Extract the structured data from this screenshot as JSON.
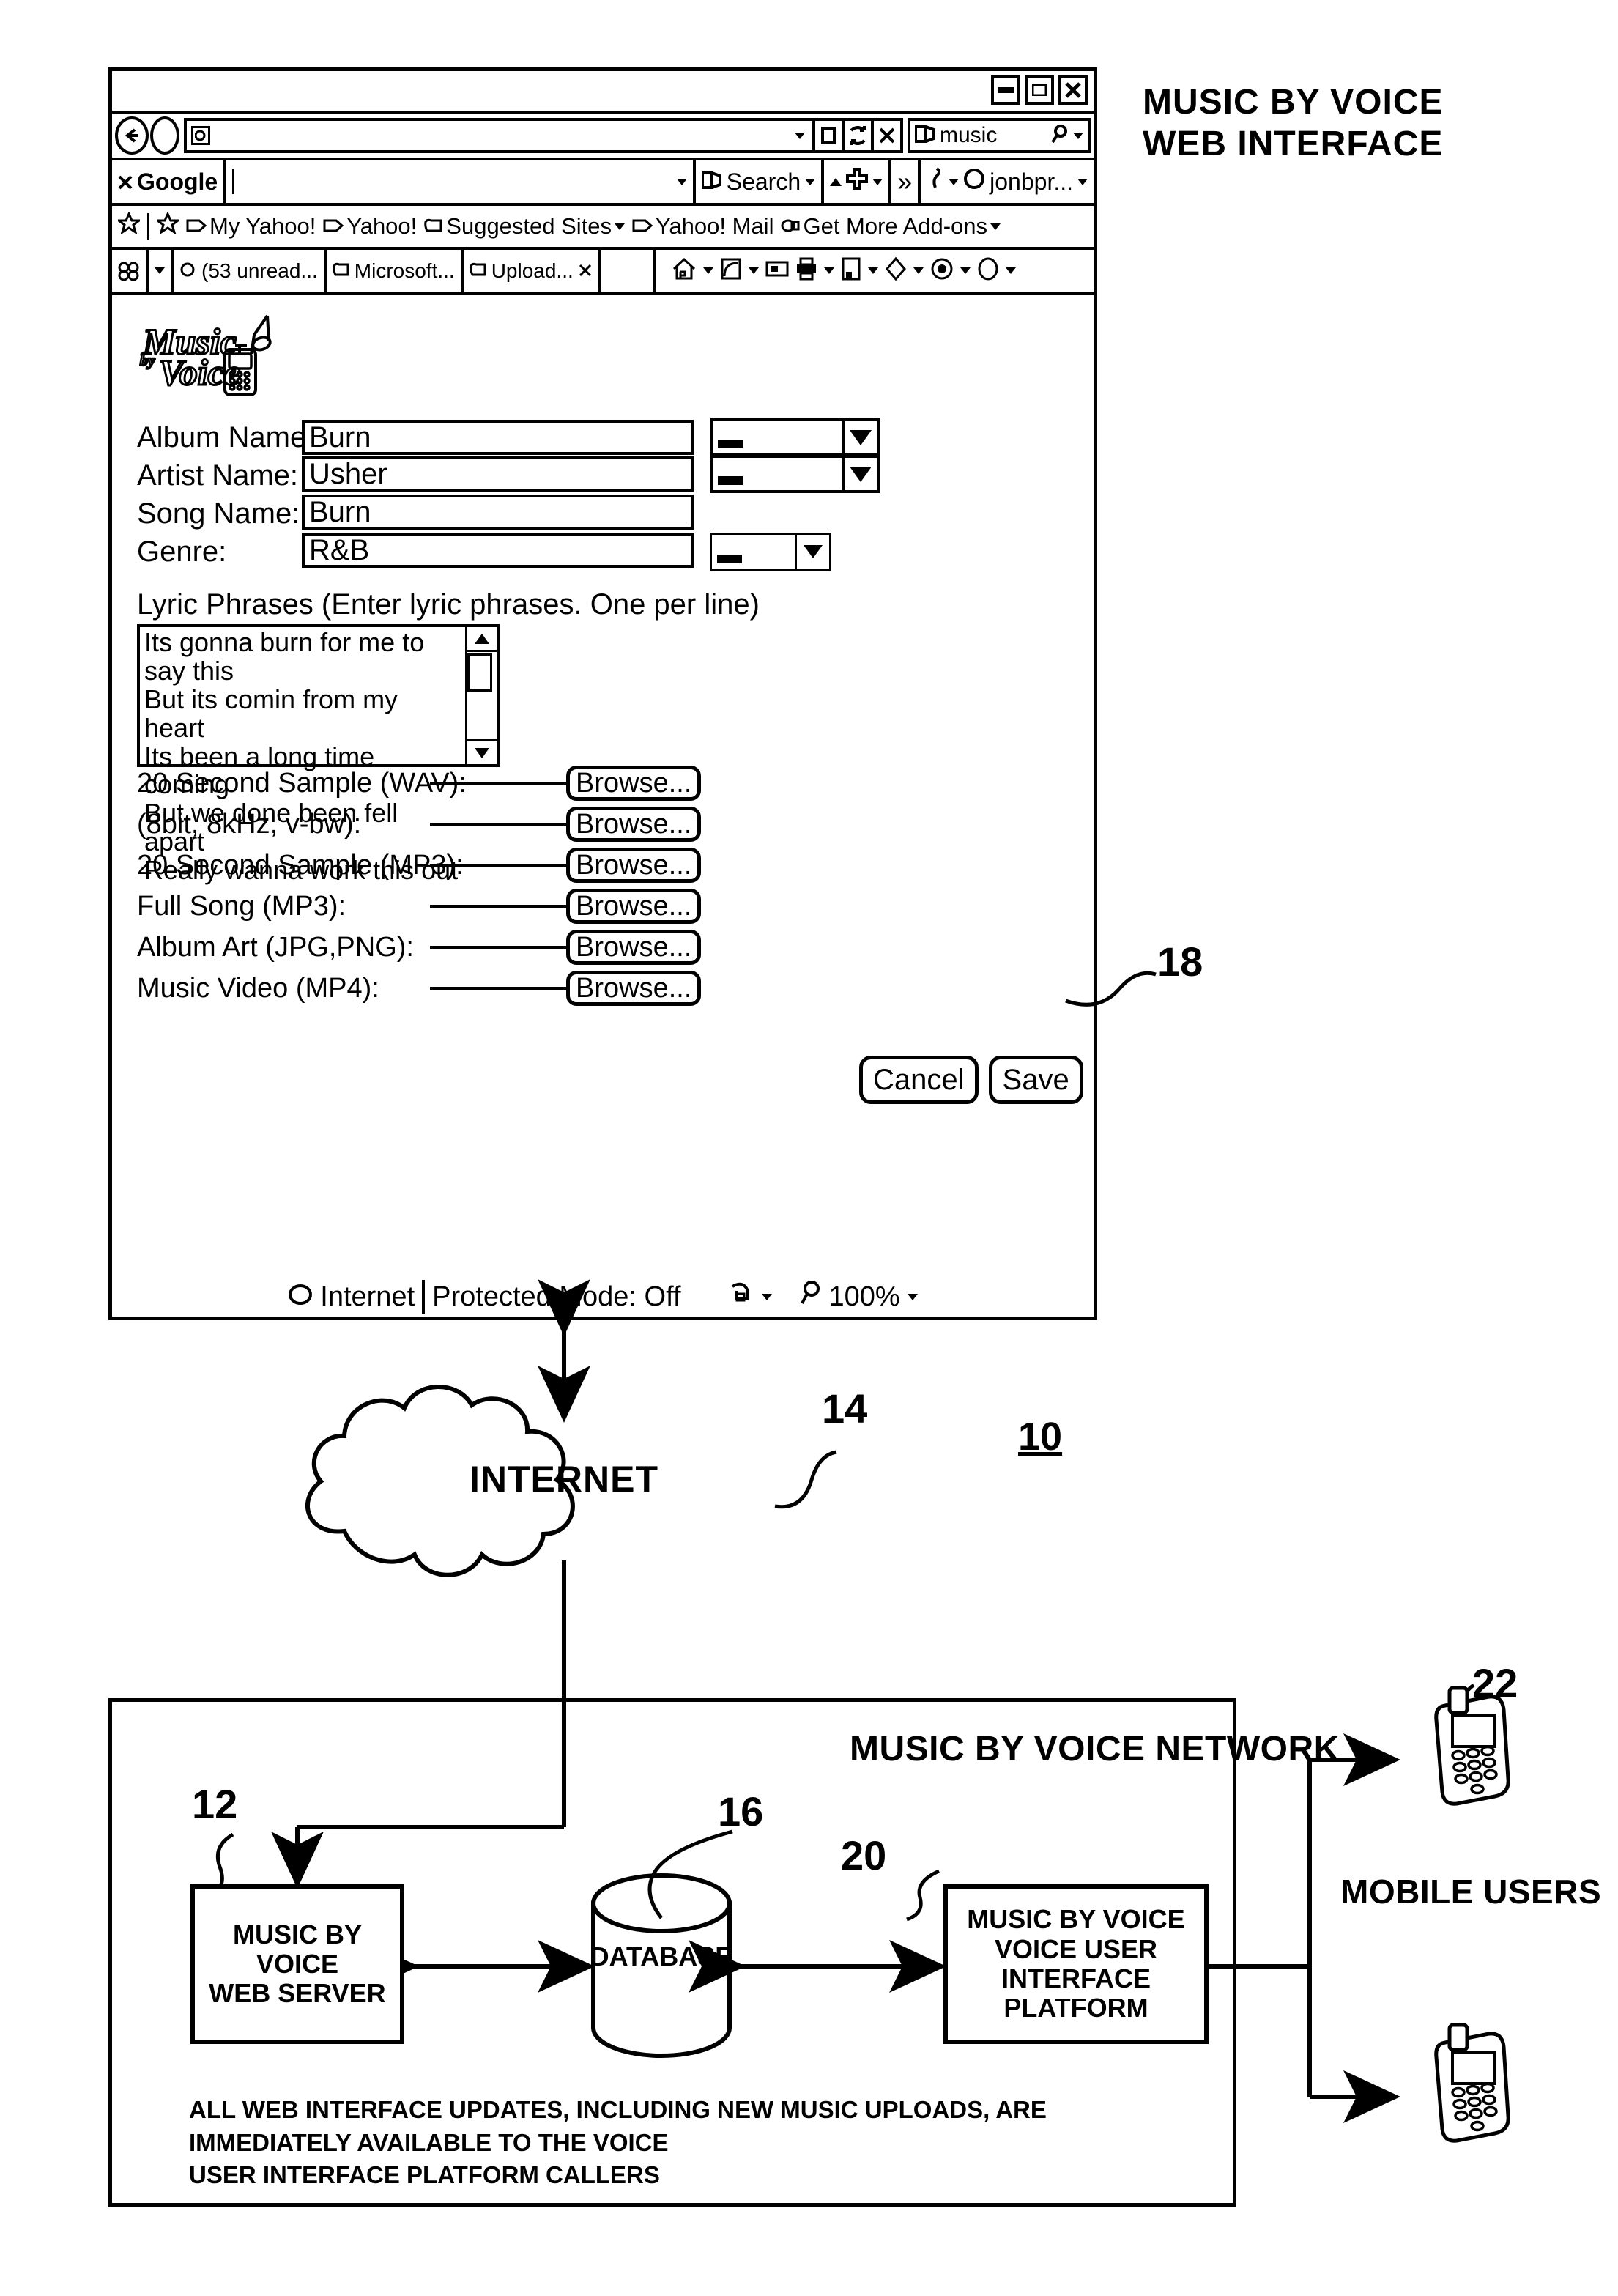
{
  "diagram": {
    "title_line1": "MUSIC BY VOICE",
    "title_line2": "WEB INTERFACE",
    "ref_browser": "18",
    "ref_cloud": "14",
    "ref_system": "10",
    "ref_webserver": "12",
    "ref_database": "16",
    "ref_vui": "20",
    "ref_mobile": "22",
    "cloud_label": "INTERNET",
    "network_label": "MUSIC BY VOICE NETWORK",
    "webserver_line1": "MUSIC BY VOICE",
    "webserver_line2": "WEB SERVER",
    "database_label": "DATABASE",
    "vui_line1": "MUSIC BY VOICE",
    "vui_line2": "VOICE USER",
    "vui_line3": "INTERFACE PLATFORM",
    "mobile_users_label": "MOBILE USERS",
    "caption_line1": "ALL WEB INTERFACE UPDATES, INCLUDING NEW MUSIC UPLOADS, ARE IMMEDIATELY AVAILABLE TO THE VOICE",
    "caption_line2": "USER INTERFACE PLATFORM CALLERS"
  },
  "browser": {
    "title": "",
    "window_buttons": [
      "minimize",
      "maximize",
      "close"
    ],
    "address": {
      "value": "",
      "placeholder": ""
    },
    "search_box": {
      "value": "music",
      "placeholder": ""
    },
    "google_toolbar": {
      "brand": "Google",
      "query": "",
      "search_label": "Search",
      "more_label": "»",
      "account_label": "jonbpr..."
    },
    "bookmarks": [
      "My Yahoo!",
      "Yahoo!",
      "Suggested Sites",
      "Yahoo! Mail",
      "Get More Add-ons"
    ],
    "tabs": [
      "(53 unread...",
      "Microsoft...",
      "Upload..."
    ],
    "status": {
      "zone": "Internet",
      "protected_mode": "Protected Mode: Off",
      "zoom": "100%"
    }
  },
  "logo": {
    "word1": "Music",
    "word2": "by",
    "word3": "Voice"
  },
  "form": {
    "fields": [
      {
        "label": "Album Name:",
        "value": "Burn",
        "has_dropdown": true
      },
      {
        "label": "Artist Name:",
        "value": "Usher",
        "has_dropdown": true
      },
      {
        "label": "Song Name:",
        "value": "Burn",
        "has_dropdown": false
      },
      {
        "label": "Genre:",
        "value": "R&B",
        "has_dropdown": true
      }
    ],
    "lyrics_label": "Lyric Phrases   (Enter lyric phrases. One per line)",
    "lyrics": [
      "Its gonna burn for me to say this",
      "But its comin from my heart",
      "Its been a long time coming",
      "But we done been fell apart",
      "Really wanna work this out"
    ],
    "uploads": [
      {
        "label": "20 Second Sample (WAV):",
        "button": "Browse..."
      },
      {
        "label": "(8bit, 8kHz, v-bw):",
        "button": "Browse..."
      },
      {
        "label": "20  Second Sample (MP3):",
        "button": "Browse..."
      },
      {
        "label": "Full Song (MP3):",
        "button": "Browse..."
      },
      {
        "label": "Album Art (JPG,PNG):",
        "button": "Browse..."
      },
      {
        "label": "Music Video (MP4):",
        "button": "Browse..."
      }
    ],
    "upload_row_labels": [
      "20 Second Sample (WAV):",
      "(8bit, 8kHz, v-bw):",
      "20  Second Sample (MP3):",
      "Full Song (MP3):",
      "Album Art (JPG,PNG):",
      "Music Video (MP4):"
    ],
    "cancel_label": "Cancel",
    "save_label": "Save"
  }
}
